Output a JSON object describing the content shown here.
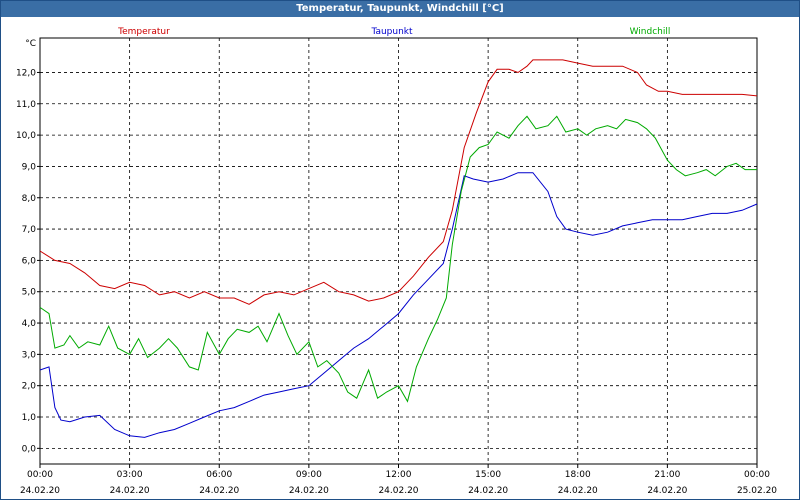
{
  "window": {
    "title": "Temperatur, Taupunkt, Windchill [°C]"
  },
  "chart_data": {
    "type": "line",
    "title": "Temperatur, Taupunkt, Windchill [°C]",
    "ylabel": "°C",
    "ylim": [
      -0.5,
      13.1
    ],
    "y_ticks": [
      "0,0",
      "1,0",
      "2,0",
      "3,0",
      "4,0",
      "5,0",
      "6,0",
      "7,0",
      "8,0",
      "9,0",
      "10,0",
      "11,0",
      "12,0"
    ],
    "x_range_hours": [
      0,
      24
    ],
    "x_ticks": [
      {
        "time": "00:00",
        "date": "24.02.20"
      },
      {
        "time": "03:00",
        "date": "24.02.20"
      },
      {
        "time": "06:00",
        "date": "24.02.20"
      },
      {
        "time": "09:00",
        "date": "24.02.20"
      },
      {
        "time": "12:00",
        "date": "24.02.20"
      },
      {
        "time": "15:00",
        "date": "24.02.20"
      },
      {
        "time": "18:00",
        "date": "24.02.20"
      },
      {
        "time": "21:00",
        "date": "24.02.20"
      },
      {
        "time": "00:00",
        "date": "25.02.20"
      }
    ],
    "grid": true,
    "legend_position": "top",
    "series": [
      {
        "name": "Temperatur",
        "color": "#cc0000",
        "points": [
          [
            0,
            6.3
          ],
          [
            0.5,
            6.0
          ],
          [
            1,
            5.9
          ],
          [
            1.5,
            5.6
          ],
          [
            2,
            5.2
          ],
          [
            2.5,
            5.1
          ],
          [
            3,
            5.3
          ],
          [
            3.5,
            5.2
          ],
          [
            4,
            4.9
          ],
          [
            4.5,
            5.0
          ],
          [
            5,
            4.8
          ],
          [
            5.5,
            5.0
          ],
          [
            6,
            4.8
          ],
          [
            6.5,
            4.8
          ],
          [
            7,
            4.6
          ],
          [
            7.5,
            4.9
          ],
          [
            8,
            5.0
          ],
          [
            8.5,
            4.9
          ],
          [
            9,
            5.1
          ],
          [
            9.5,
            5.3
          ],
          [
            10,
            5.0
          ],
          [
            10.5,
            4.9
          ],
          [
            11,
            4.7
          ],
          [
            11.5,
            4.8
          ],
          [
            12,
            5.0
          ],
          [
            12.5,
            5.5
          ],
          [
            13,
            6.1
          ],
          [
            13.5,
            6.6
          ],
          [
            13.8,
            7.6
          ],
          [
            14.2,
            9.6
          ],
          [
            14.6,
            10.7
          ],
          [
            15,
            11.7
          ],
          [
            15.3,
            12.1
          ],
          [
            15.7,
            12.1
          ],
          [
            16,
            12.0
          ],
          [
            16.3,
            12.2
          ],
          [
            16.5,
            12.4
          ],
          [
            17,
            12.4
          ],
          [
            17.5,
            12.4
          ],
          [
            18,
            12.3
          ],
          [
            18.5,
            12.2
          ],
          [
            19,
            12.2
          ],
          [
            19.5,
            12.2
          ],
          [
            20,
            12.0
          ],
          [
            20.3,
            11.6
          ],
          [
            20.7,
            11.4
          ],
          [
            21,
            11.4
          ],
          [
            21.5,
            11.3
          ],
          [
            22,
            11.3
          ],
          [
            22.5,
            11.3
          ],
          [
            23,
            11.3
          ],
          [
            23.5,
            11.3
          ],
          [
            24,
            11.25
          ]
        ]
      },
      {
        "name": "Taupunkt",
        "color": "#0000cc",
        "points": [
          [
            0,
            2.5
          ],
          [
            0.3,
            2.6
          ],
          [
            0.5,
            1.3
          ],
          [
            0.7,
            0.9
          ],
          [
            1,
            0.85
          ],
          [
            1.5,
            1.0
          ],
          [
            2,
            1.05
          ],
          [
            2.5,
            0.6
          ],
          [
            3,
            0.4
          ],
          [
            3.5,
            0.35
          ],
          [
            4,
            0.5
          ],
          [
            4.5,
            0.6
          ],
          [
            5,
            0.8
          ],
          [
            5.5,
            1.0
          ],
          [
            6,
            1.2
          ],
          [
            6.5,
            1.3
          ],
          [
            7,
            1.5
          ],
          [
            7.5,
            1.7
          ],
          [
            8,
            1.8
          ],
          [
            8.5,
            1.9
          ],
          [
            9,
            2.0
          ],
          [
            9.5,
            2.4
          ],
          [
            10,
            2.8
          ],
          [
            10.5,
            3.2
          ],
          [
            11,
            3.5
          ],
          [
            11.5,
            3.9
          ],
          [
            12,
            4.3
          ],
          [
            12.5,
            4.9
          ],
          [
            13,
            5.4
          ],
          [
            13.5,
            5.9
          ],
          [
            13.8,
            7.0
          ],
          [
            14.2,
            8.7
          ],
          [
            14.5,
            8.6
          ],
          [
            15,
            8.5
          ],
          [
            15.5,
            8.6
          ],
          [
            16,
            8.8
          ],
          [
            16.5,
            8.8
          ],
          [
            17,
            8.2
          ],
          [
            17.3,
            7.4
          ],
          [
            17.6,
            7.0
          ],
          [
            18,
            6.9
          ],
          [
            18.5,
            6.8
          ],
          [
            19,
            6.9
          ],
          [
            19.5,
            7.1
          ],
          [
            20,
            7.2
          ],
          [
            20.5,
            7.3
          ],
          [
            21,
            7.3
          ],
          [
            21.5,
            7.3
          ],
          [
            22,
            7.4
          ],
          [
            22.5,
            7.5
          ],
          [
            23,
            7.5
          ],
          [
            23.5,
            7.6
          ],
          [
            24,
            7.8
          ]
        ]
      },
      {
        "name": "Windchill",
        "color": "#00aa00",
        "points": [
          [
            0,
            4.5
          ],
          [
            0.3,
            4.3
          ],
          [
            0.5,
            3.2
          ],
          [
            0.8,
            3.3
          ],
          [
            1,
            3.6
          ],
          [
            1.3,
            3.2
          ],
          [
            1.6,
            3.4
          ],
          [
            2,
            3.3
          ],
          [
            2.3,
            3.9
          ],
          [
            2.6,
            3.2
          ],
          [
            3,
            3.0
          ],
          [
            3.3,
            3.5
          ],
          [
            3.6,
            2.9
          ],
          [
            4,
            3.2
          ],
          [
            4.3,
            3.5
          ],
          [
            4.6,
            3.2
          ],
          [
            5,
            2.6
          ],
          [
            5.3,
            2.5
          ],
          [
            5.6,
            3.7
          ],
          [
            6,
            3.0
          ],
          [
            6.3,
            3.5
          ],
          [
            6.6,
            3.8
          ],
          [
            7,
            3.7
          ],
          [
            7.3,
            3.9
          ],
          [
            7.6,
            3.4
          ],
          [
            8,
            4.3
          ],
          [
            8.3,
            3.6
          ],
          [
            8.6,
            3.0
          ],
          [
            9,
            3.4
          ],
          [
            9.3,
            2.6
          ],
          [
            9.6,
            2.8
          ],
          [
            10,
            2.4
          ],
          [
            10.3,
            1.8
          ],
          [
            10.6,
            1.6
          ],
          [
            11,
            2.5
          ],
          [
            11.3,
            1.6
          ],
          [
            11.6,
            1.8
          ],
          [
            12,
            2.0
          ],
          [
            12.3,
            1.5
          ],
          [
            12.6,
            2.6
          ],
          [
            13,
            3.5
          ],
          [
            13.3,
            4.1
          ],
          [
            13.6,
            4.8
          ],
          [
            13.8,
            6.5
          ],
          [
            14.1,
            8.2
          ],
          [
            14.4,
            9.3
          ],
          [
            14.7,
            9.6
          ],
          [
            15,
            9.7
          ],
          [
            15.3,
            10.1
          ],
          [
            15.7,
            9.9
          ],
          [
            16,
            10.3
          ],
          [
            16.3,
            10.6
          ],
          [
            16.6,
            10.2
          ],
          [
            17,
            10.3
          ],
          [
            17.3,
            10.6
          ],
          [
            17.6,
            10.1
          ],
          [
            18,
            10.2
          ],
          [
            18.3,
            10.0
          ],
          [
            18.6,
            10.2
          ],
          [
            19,
            10.3
          ],
          [
            19.3,
            10.2
          ],
          [
            19.6,
            10.5
          ],
          [
            20,
            10.4
          ],
          [
            20.3,
            10.2
          ],
          [
            20.6,
            9.9
          ],
          [
            21,
            9.2
          ],
          [
            21.3,
            8.9
          ],
          [
            21.6,
            8.7
          ],
          [
            22,
            8.8
          ],
          [
            22.3,
            8.9
          ],
          [
            22.6,
            8.7
          ],
          [
            23,
            9.0
          ],
          [
            23.3,
            9.1
          ],
          [
            23.6,
            8.9
          ],
          [
            24,
            8.9
          ]
        ]
      }
    ]
  }
}
